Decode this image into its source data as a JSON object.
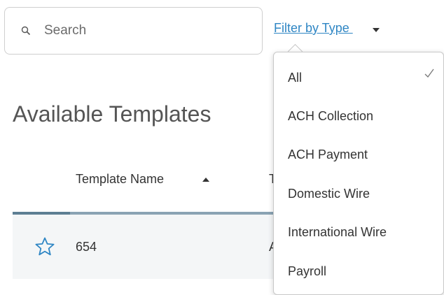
{
  "search": {
    "placeholder": "Search",
    "value": ""
  },
  "filter": {
    "label": "Filter by Type ",
    "options": [
      {
        "label": "All",
        "selected": true
      },
      {
        "label": "ACH Collection",
        "selected": false
      },
      {
        "label": "ACH Payment",
        "selected": false
      },
      {
        "label": "Domestic Wire",
        "selected": false
      },
      {
        "label": "International Wire",
        "selected": false
      },
      {
        "label": "Payroll",
        "selected": false
      }
    ]
  },
  "main": {
    "title": "Available Templates",
    "table": {
      "columns": [
        {
          "label": "Template Name",
          "sort": "ascending"
        },
        {
          "label": "T"
        }
      ],
      "rows": [
        {
          "name": "654",
          "type": "A",
          "favorite": false
        }
      ]
    }
  },
  "colors": {
    "link": "#2f86c4",
    "star": "#2f86c4",
    "header_rule": "#5d7f93",
    "row_background": "#f4f6f7"
  },
  "icons": {
    "search": "search-icon",
    "filter_caret": "caret-down-icon",
    "sort": "sort-ascending-icon",
    "favorite": "star-outline-icon",
    "selected": "check-icon"
  }
}
